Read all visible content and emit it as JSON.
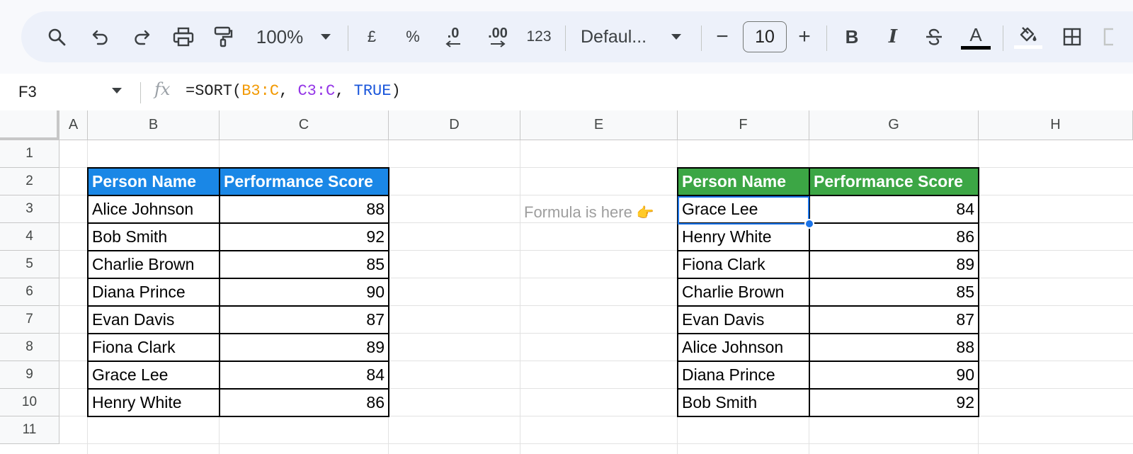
{
  "toolbar": {
    "zoom": "100%",
    "currency": "£",
    "percent": "%",
    "decrease_decimal": ".0",
    "increase_decimal": ".00",
    "number_format": "123",
    "font": "Defaul...",
    "font_size": "10",
    "minus": "−",
    "plus": "+",
    "bold": "B",
    "italic": "I",
    "text_color": "A"
  },
  "formula_bar": {
    "cell_ref": "F3",
    "fx": "fx",
    "formula_prefix": "=SORT(",
    "arg1": "B3:C",
    "comma1": ", ",
    "arg2": "C3:C",
    "comma2": ", ",
    "arg3": "TRUE",
    "formula_suffix": ")"
  },
  "columns": [
    "A",
    "B",
    "C",
    "D",
    "E",
    "F",
    "G",
    "H"
  ],
  "rows": [
    "1",
    "2",
    "3",
    "4",
    "5",
    "6",
    "7",
    "8",
    "9",
    "10",
    "11"
  ],
  "source_table": {
    "header_name": "Person Name",
    "header_score": "Performance Score",
    "rows": [
      {
        "name": "Alice Johnson",
        "score": "88"
      },
      {
        "name": "Bob Smith",
        "score": "92"
      },
      {
        "name": "Charlie Brown",
        "score": "85"
      },
      {
        "name": "Diana Prince",
        "score": "90"
      },
      {
        "name": "Evan Davis",
        "score": "87"
      },
      {
        "name": "Fiona Clark",
        "score": "89"
      },
      {
        "name": "Grace Lee",
        "score": "84"
      },
      {
        "name": "Henry White",
        "score": "86"
      }
    ]
  },
  "sorted_table": {
    "header_name": "Person Name",
    "header_score": "Performance Score",
    "rows": [
      {
        "name": "Grace Lee",
        "score": "84"
      },
      {
        "name": "Henry White",
        "score": "86"
      },
      {
        "name": "Fiona Clark",
        "score": "89"
      },
      {
        "name": "Charlie Brown",
        "score": "85"
      },
      {
        "name": "Evan Davis",
        "score": "87"
      },
      {
        "name": "Alice Johnson",
        "score": "88"
      },
      {
        "name": "Diana Prince",
        "score": "90"
      },
      {
        "name": "Bob Smith",
        "score": "92"
      }
    ]
  },
  "note": {
    "text": "Formula is here",
    "hand": "👉"
  },
  "colors": {
    "header_blue": "#1a87e6",
    "header_green": "#3ca645",
    "selection": "#1a73e8"
  }
}
